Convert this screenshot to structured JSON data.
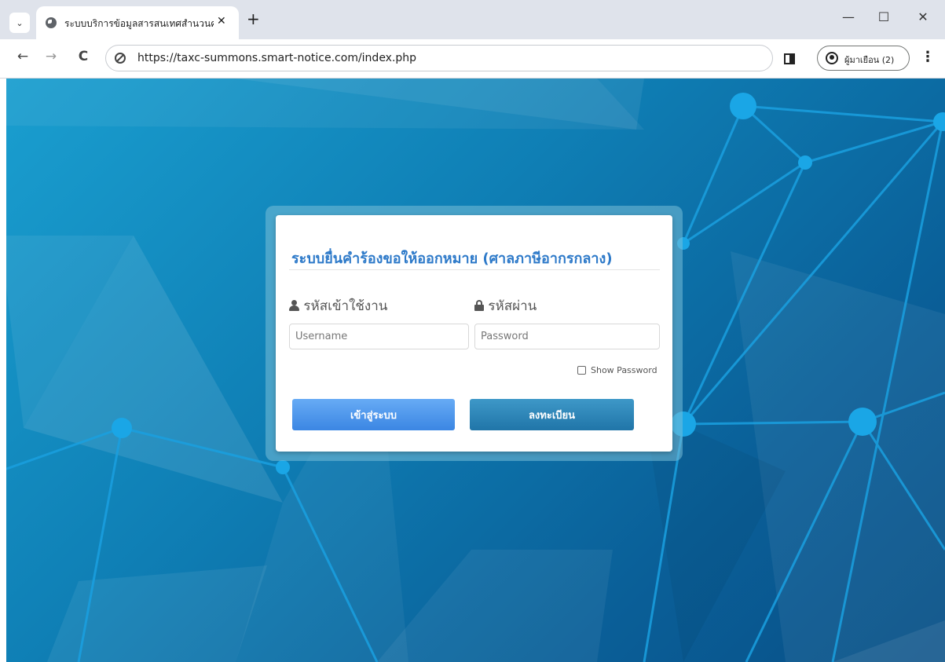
{
  "browser": {
    "tab_title": "ระบบบริการข้อมูลสารสนเทศสำนวนค",
    "tab_close_glyph": "✕",
    "new_tab_glyph": "+",
    "tab_list_glyph": "⌄",
    "minimize_glyph": "—",
    "maximize_glyph": "☐",
    "close_glyph": "✕",
    "back_glyph": "←",
    "forward_glyph": "→",
    "reload_glyph": "C",
    "url": "https://taxc-summons.smart-notice.com/index.php",
    "profile_label": "ผู้มาเยือน (2)",
    "menu_glyph": "⋮"
  },
  "login": {
    "title": "ระบบยื่นคำร้องขอให้ออกหมาย (ศาลภาษีอากรกลาง)",
    "username_label": "รหัสเข้าใช้งาน",
    "username_placeholder": "Username",
    "password_label": "รหัสผ่าน",
    "password_placeholder": "Password",
    "show_password_label": "Show Password",
    "login_button": "เข้าสู่ระบบ",
    "register_button": "ลงทะเบียน"
  },
  "icons": {
    "username": "user-icon",
    "password": "lock-icon",
    "site_info": "site-info-icon",
    "profile": "profile-icon",
    "side_panel": "side-panel-icon"
  },
  "colors": {
    "title": "#2e7ac9",
    "login_button": "#3b86e3",
    "register_button": "#2075a8",
    "background": "#0f7fb5"
  }
}
